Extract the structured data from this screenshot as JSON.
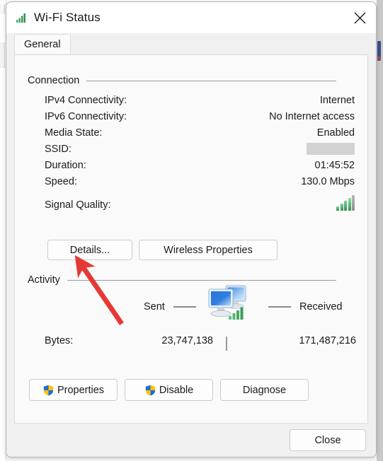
{
  "window": {
    "title": "Wi-Fi Status",
    "title_icon": "wifi-signal-bars-icon",
    "close_icon": "close-icon"
  },
  "tabs": [
    {
      "label": "General",
      "selected": true
    }
  ],
  "connection": {
    "group_label": "Connection",
    "rows": [
      {
        "label": "IPv4 Connectivity:",
        "value": "Internet"
      },
      {
        "label": "IPv6 Connectivity:",
        "value": "No Internet access"
      },
      {
        "label": "Media State:",
        "value": "Enabled"
      },
      {
        "label": "SSID:",
        "value": "",
        "redacted": true
      },
      {
        "label": "Duration:",
        "value": "01:45:52"
      },
      {
        "label": "Speed:",
        "value": "130.0 Mbps"
      },
      {
        "label": "Signal Quality:",
        "value": "",
        "icon": "signal-bars-icon"
      }
    ],
    "buttons": [
      {
        "label": "Details...",
        "name": "details-button"
      },
      {
        "label": "Wireless Properties",
        "name": "wireless-properties-button"
      }
    ]
  },
  "activity": {
    "group_label": "Activity",
    "sent_label": "Sent",
    "received_label": "Received",
    "center_icon": "network-activity-computers-icon",
    "bytes_label": "Bytes:",
    "bytes_sent": "23,747,138",
    "bytes_received": "171,487,216"
  },
  "action_buttons": [
    {
      "label": "Properties",
      "name": "properties-button",
      "shield": true
    },
    {
      "label": "Disable",
      "name": "disable-button",
      "shield": true
    },
    {
      "label": "Diagnose",
      "name": "diagnose-button",
      "shield": false
    }
  ],
  "footer": {
    "close_label": "Close"
  },
  "annotation": {
    "type": "arrow",
    "color": "#e53935",
    "points_at": "details-button"
  },
  "colors": {
    "signal_green": "#2f8f52",
    "shield_blue": "#1f6fd0",
    "shield_yellow": "#ffc20e",
    "annotation_red": "#e53935",
    "redaction_gray": "#d2d2d2"
  }
}
